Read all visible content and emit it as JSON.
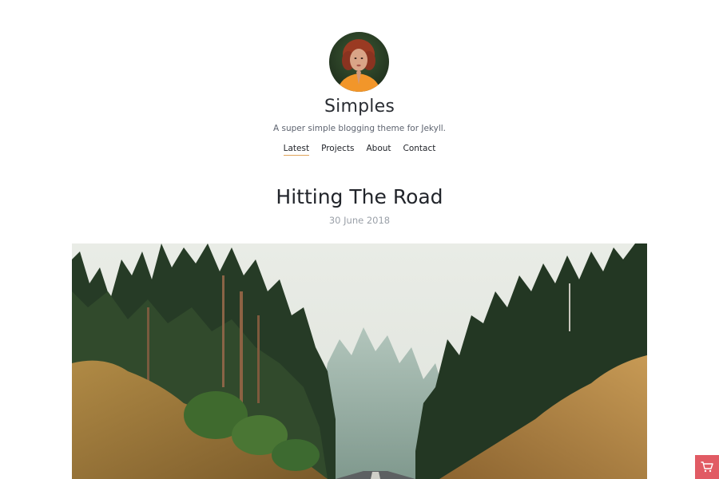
{
  "site": {
    "title": "Simples",
    "tagline": "A super simple blogging theme for Jekyll."
  },
  "nav": {
    "items": [
      {
        "label": "Latest",
        "active": true
      },
      {
        "label": "Projects",
        "active": false
      },
      {
        "label": "About",
        "active": false
      },
      {
        "label": "Contact",
        "active": false
      }
    ]
  },
  "post": {
    "title": "Hitting The Road",
    "date": "30 June 2018"
  },
  "icons": {
    "cart": "cart-icon"
  },
  "colors": {
    "nav_active_underline": "#e0a35a",
    "cart_button": "#e15b64",
    "text_dark": "#22252b",
    "text_muted": "#9aa0a8"
  }
}
